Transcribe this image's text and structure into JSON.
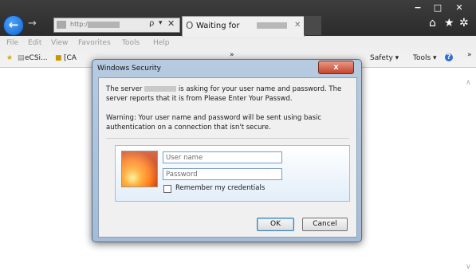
{
  "window": {
    "minimize": "−",
    "maximize": "□",
    "close": "✕"
  },
  "nav": {
    "back_icon": "←",
    "forward_icon": "→",
    "address_prefix": "http://",
    "search_icon": "ρ",
    "dropdown_icon": "▾",
    "stop_icon": "✕"
  },
  "tab": {
    "icon": "O",
    "label": "Waiting for",
    "close": "✕"
  },
  "chrome_icons": {
    "home": "⌂",
    "favorites": "★",
    "settings": "✲"
  },
  "menu": [
    "File",
    "Edit",
    "View",
    "Favorites",
    "Tools",
    "Help"
  ],
  "favorites_bar": {
    "items": [
      "eCSi...",
      "[CA"
    ],
    "overflow": "»"
  },
  "command_bar": {
    "safety": "Safety ▾",
    "tools": "Tools ▾",
    "help": "?",
    "overflow": "»"
  },
  "scrollbar": {
    "up_icon": "∧",
    "down_icon": "∨"
  },
  "dialog": {
    "title": "Windows Security",
    "close_label": "x",
    "server_message_part1": "The server",
    "server_message_part2": "is asking for your user name and password. The server reports that it is from Please Enter Your Passwd.",
    "warning_message": "Warning: Your user name and password will be sent using basic authentication on a connection that isn't secure.",
    "username_placeholder": "User name",
    "password_placeholder": "Password",
    "remember_label": "Remember my credentials",
    "ok_label": "OK",
    "cancel_label": "Cancel"
  },
  "colors": {
    "accent": "#1464c9",
    "dialog_frame": "#b7cbe0",
    "close_button": "#c7442a"
  }
}
